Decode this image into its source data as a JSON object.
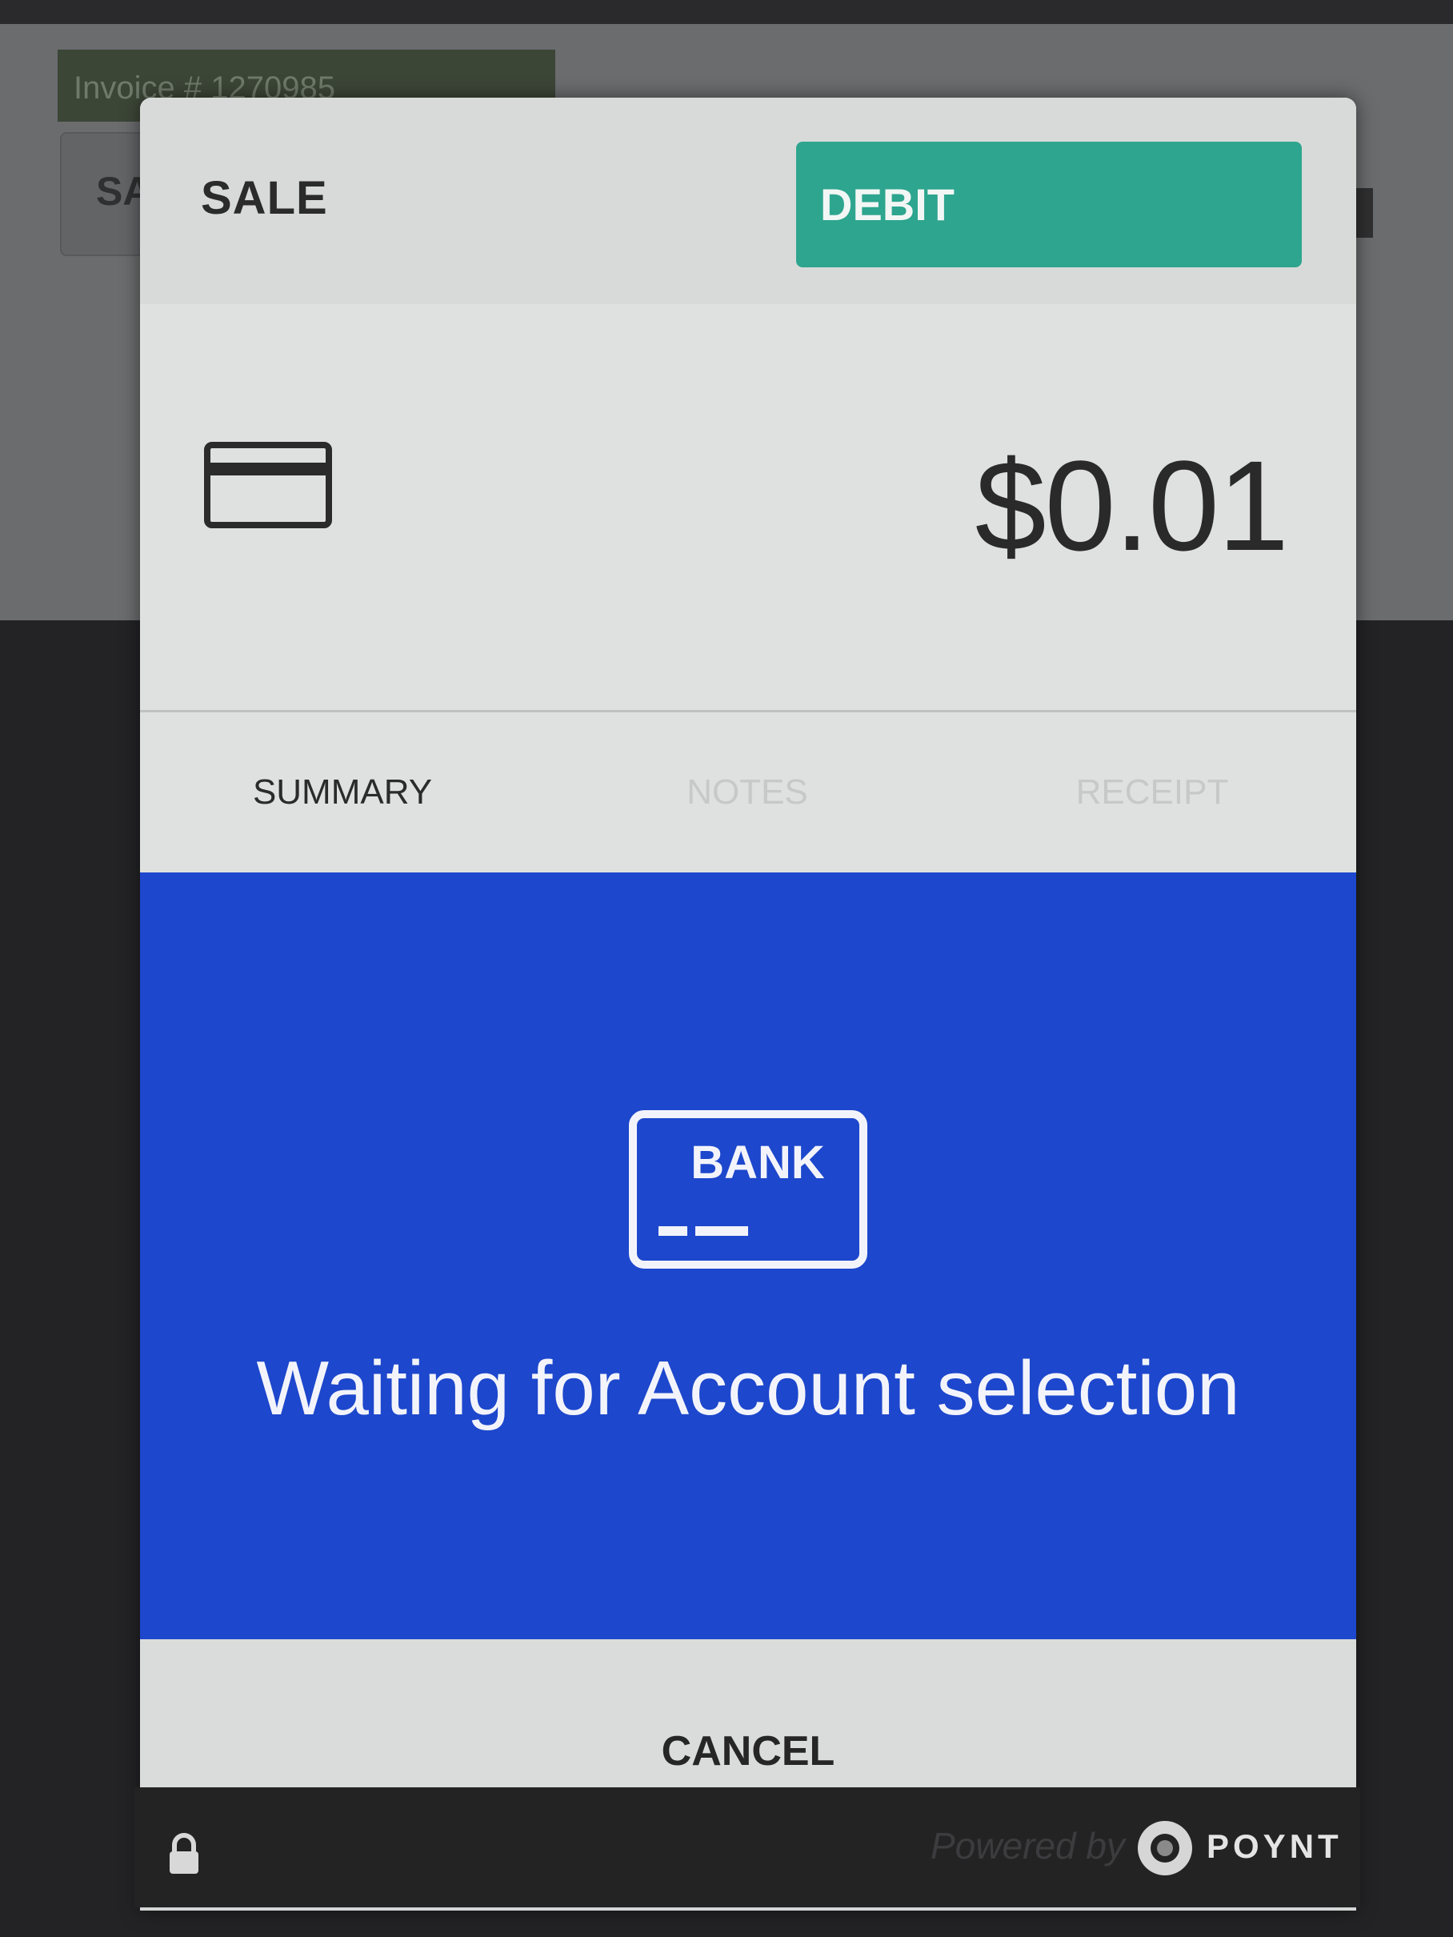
{
  "background": {
    "invoice_label": "Invoice # 1270985",
    "sale_label": "SA"
  },
  "modal": {
    "title": "SALE",
    "payment_type_button": "DEBIT",
    "amount": "$0.01",
    "tabs": [
      {
        "label": "SUMMARY",
        "active": true
      },
      {
        "label": "NOTES",
        "active": false
      },
      {
        "label": "RECEIPT",
        "active": false
      }
    ],
    "status": {
      "icon_label": "BANK",
      "message": "Waiting for Account selection"
    },
    "cancel_label": "CANCEL"
  },
  "footer": {
    "powered_by": "Powered by",
    "brand": "POYNT"
  },
  "colors": {
    "debit_button": "#2ea58e",
    "status_panel": "#1d47cc"
  }
}
